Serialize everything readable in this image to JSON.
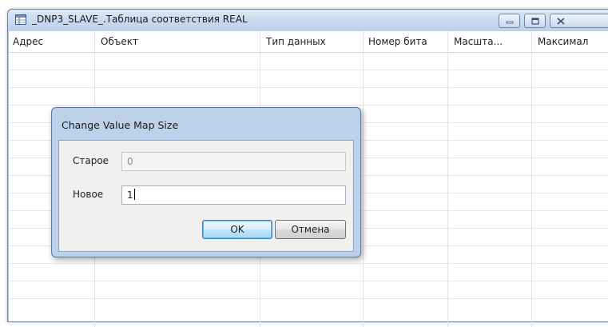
{
  "window": {
    "title": "_DNP3_SLAVE_.Таблица соответствия REAL"
  },
  "grid": {
    "columns": [
      "Адрес",
      "Объект",
      "Тип данных",
      "Номер бита",
      "Масшта...",
      "Максимал"
    ]
  },
  "dialog": {
    "title": "Change Value Map Size",
    "old_label": "Старое",
    "old_value": "0",
    "new_label": "Новое",
    "new_value": "1",
    "ok_label": "OK",
    "cancel_label": "Отмена"
  },
  "colors": {
    "frame": "#b9d1ea",
    "dialog_frame": "#bcd2ea",
    "dialog_body": "#f0f0f0",
    "default_button": "#bee6fd"
  }
}
